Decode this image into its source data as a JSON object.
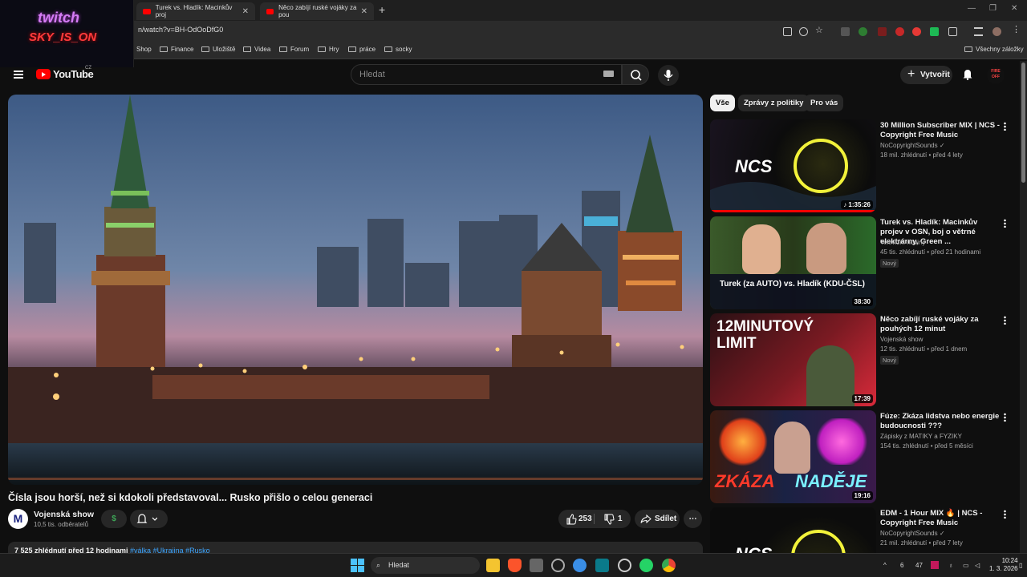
{
  "browser": {
    "tabs": [
      {
        "title": "Turek vs. Hladík: Macinkův proj"
      },
      {
        "title": "Něco zabíjí ruské vojáky za pou"
      }
    ],
    "new_tab": "+",
    "url": "n/watch?v=BH-OdOoDfG0",
    "bookmarks": [
      "Shop",
      "Finance",
      "Uložiště",
      "Videa",
      "Forum",
      "Hry",
      "práce",
      "socky"
    ],
    "all_bookmarks": "Všechny záložky"
  },
  "overlay": {
    "line1": "twitch",
    "line2": "SKY_IS_ON"
  },
  "youtube": {
    "logo": "YouTube",
    "country": "CZ",
    "search_placeholder": "Hledat",
    "create_label": "Vytvořit",
    "avatar_text": "FIRE OFF"
  },
  "video": {
    "title": "Čísla jsou horší, než si kdokoli představoval... Rusko přišlo o celou generaci",
    "channel": "Vojenská show",
    "channel_initial": "M",
    "subscribers": "10,5 tis. odběratelů",
    "donate_symbol": "$",
    "likes": "253",
    "dislikes": "1",
    "share_label": "Sdílet",
    "more_label": "⋯",
    "views_time": "7 525 zhlédnutí  před 12 hodinami",
    "tags": "#válka #Ukrajina #Rusko"
  },
  "chips": [
    "Vše",
    "Zprávy z politiky",
    "Pro vás"
  ],
  "recommendations": [
    {
      "title": "30 Million Subscriber MIX | NCS - Copyright Free Music",
      "channel": "NoCopyrightSounds ✓",
      "meta": "18 mil. zhlédnutí • před 4 lety",
      "duration": "♪ 1:35:26",
      "badge": "",
      "thumb_text": "NCS",
      "progress": 1.0
    },
    {
      "title": "Turek vs. Hladík: Macinkův projev v OSN, boj o větrné elektrárny, Green ...",
      "channel": "Televizní noviny",
      "meta": "45 tis. zhlédnutí • před 21 hodinami",
      "duration": "38:30",
      "badge": "Nový",
      "thumb_text": "Turek (za AUTO) vs. Hladík (KDU-ČSL)",
      "progress": 0
    },
    {
      "title": "Něco zabíjí ruské vojáky za pouhých 12 minut",
      "channel": "Vojenská show",
      "meta": "12 tis. zhlédnutí • před 1 dnem",
      "duration": "17:39",
      "badge": "Nový",
      "thumb_text": "12MINUTOVÝ LIMIT",
      "progress": 0
    },
    {
      "title": "Fúze: Zkáza lidstva nebo energie budoucnosti ???",
      "channel": "Zápisky z MATIKY a FYZIKY",
      "meta": "154 tis. zhlédnutí • před 5 měsíci",
      "duration": "19:16",
      "badge": "",
      "thumb_text_left": "ZKÁZA",
      "thumb_text_right": "NADĚJE",
      "progress": 0
    },
    {
      "title": "EDM - 1 Hour MIX 🔥 | NCS - Copyright Free Music",
      "channel": "NoCopyrightSounds ✓",
      "meta": "21 mil. zhlédnutí • před 7 lety",
      "duration": "",
      "badge": "",
      "thumb_text": "NCS",
      "progress": 0
    }
  ],
  "taskbar": {
    "search_placeholder": "Hledat",
    "tray_nums": [
      "6",
      "47"
    ],
    "time": "10:24",
    "date": "1. 3. 2026"
  }
}
